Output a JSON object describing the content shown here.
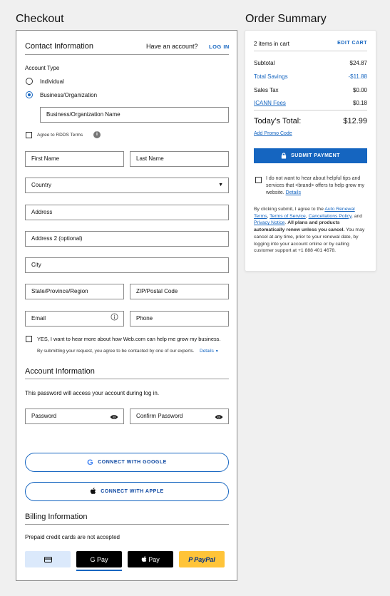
{
  "checkout": {
    "title": "Checkout",
    "contact": {
      "title": "Contact Information",
      "have_account": "Have an account?",
      "login": "LOG IN",
      "account_type_label": "Account Type",
      "options": [
        "Individual",
        "Business/Organization"
      ],
      "selected_option": "Business/Organization",
      "business_name_placeholder": "Business/Organization Name",
      "rdds_label": "Agree to RDDS Terms",
      "fields": {
        "first_name": "First Name",
        "last_name": "Last Name",
        "country": "Country",
        "address": "Address",
        "address2": "Address 2 (optional)",
        "city": "City",
        "state": "State/Province/Region",
        "zip": "ZIP/Postal Code",
        "email": "Email",
        "phone": "Phone"
      },
      "marketing_label": "YES, I want to hear more about how Web.com can help me grow my business.",
      "consent_text": "By submitting your request, you agree to be contacted by one of our experts.",
      "details_link": "Details"
    },
    "account": {
      "title": "Account Information",
      "description": "This password will access your account during log in.",
      "password": "Password",
      "confirm_password": "Confirm Password",
      "connect_google": "CONNECT WITH GOOGLE",
      "connect_apple": "CONNECT WITH APPLE"
    },
    "billing": {
      "title": "Billing Information",
      "note": "Prepaid credit cards are not accepted",
      "gpay": "G Pay",
      "applepay": "Pay",
      "paypal": "PayPal"
    }
  },
  "summary": {
    "title": "Order Summary",
    "items_in_cart": "2 items in cart",
    "edit_cart": "EDIT CART",
    "rows": [
      {
        "label": "Subtotal",
        "value": "$24.87"
      },
      {
        "label": "Total Savings",
        "value": "-$11.88"
      },
      {
        "label": "Sales Tax",
        "value": "$0.00"
      },
      {
        "label": "ICANN Fees",
        "value": "$0.18"
      }
    ],
    "total_label": "Today’s Total:",
    "total_value": "$12.99",
    "promo": "Add Promo Code",
    "submit": "SUBMIT PAYMENT",
    "optout_text": "I do not want to hear about helpful tips and services that <brand> offers to help grow my website.",
    "optout_details": "Details",
    "legal": {
      "prefix": "By clicking submit, I agree to the",
      "link1": "Auto Renewal Terms",
      "link2": "Terms of Service",
      "link3": "Cancellations Policy",
      "and": "and",
      "link4": "Privacy Notice",
      "bold": "All plans and products automatically renew unless you cancel.",
      "rest": "You may cancel at any time, prior to your renewal date, by logging into your account online or by calling customer support at +1 888 401 4678."
    }
  },
  "colors": {
    "accent": "#1565c0",
    "savings": "#1565c0",
    "paypal_bg": "#ffc439",
    "card_bg": "#dbe9fb"
  }
}
